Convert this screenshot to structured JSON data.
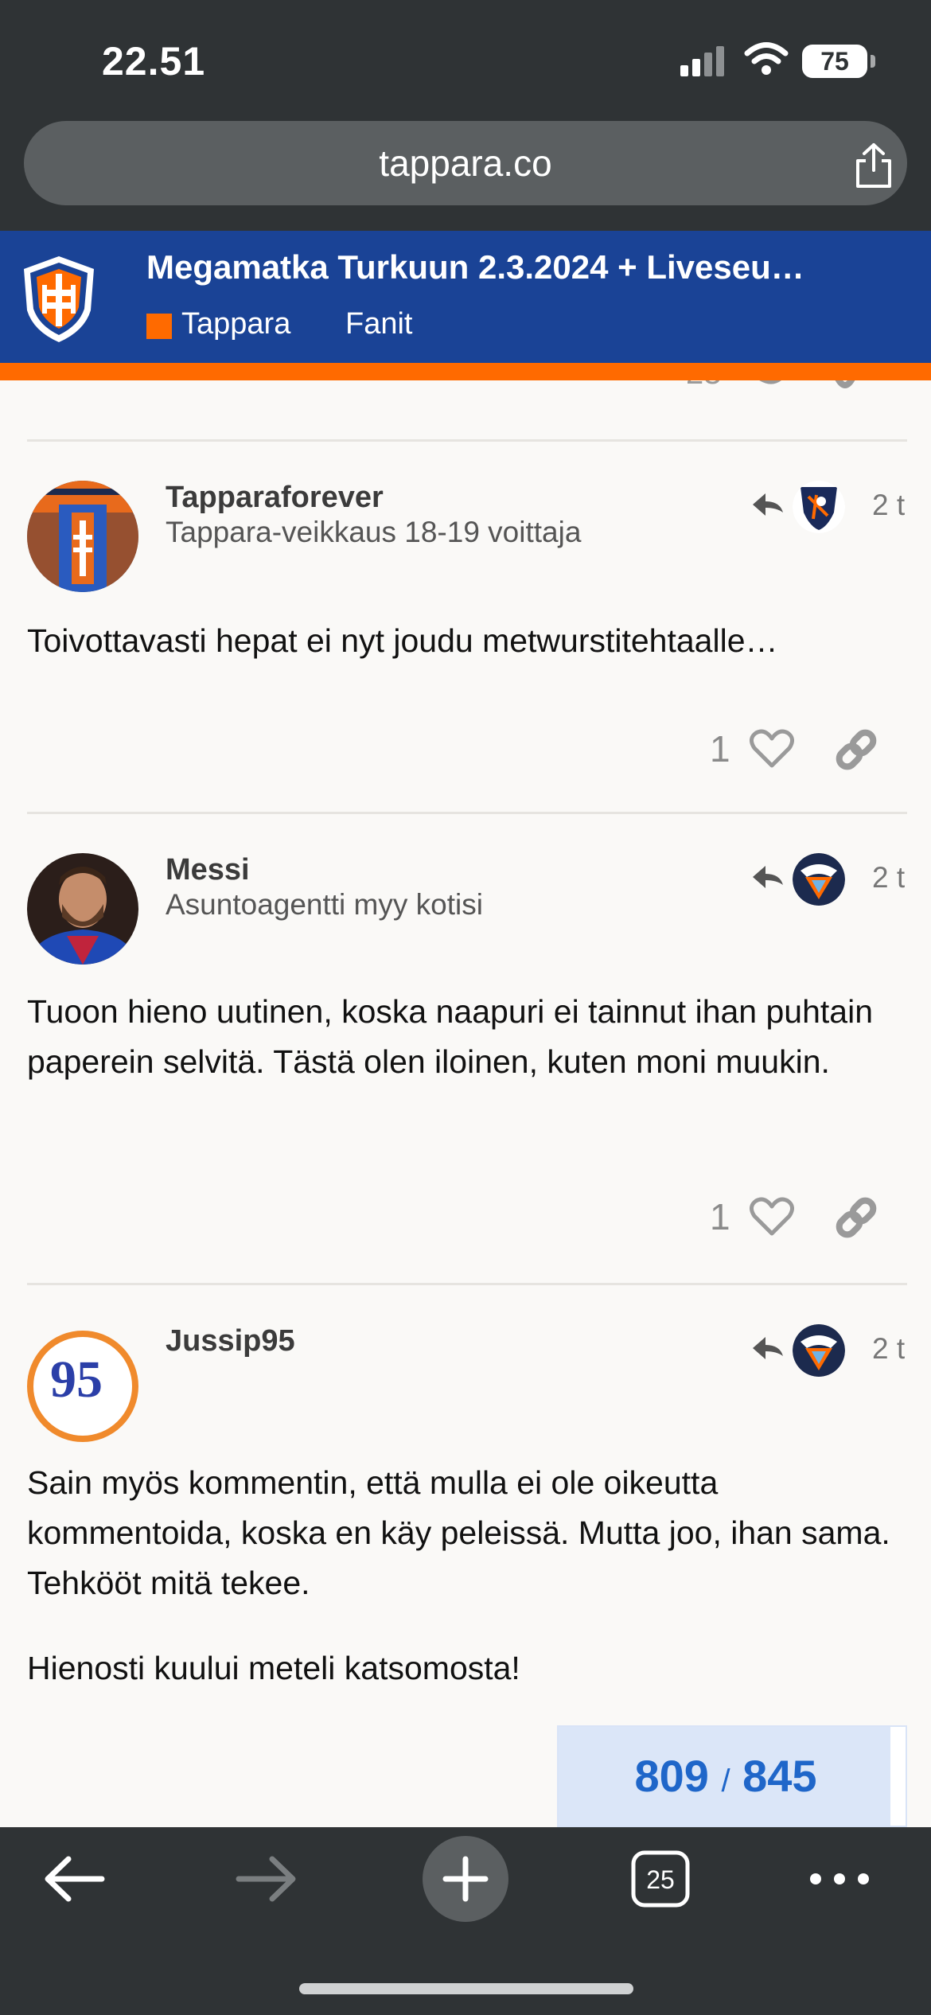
{
  "status_bar": {
    "time": "22.51",
    "battery": "75"
  },
  "browser": {
    "url": "tappara.co",
    "tab_count": "25"
  },
  "forum": {
    "topic_title": "Megamatka Turkuun 2.3.2024 + Liveseu…",
    "category": "Tappara",
    "subcategory": "Fanit",
    "accent_color": "#ff6a00",
    "header_color": "#1a4396"
  },
  "posts": [
    {
      "username": "Tapparaforever",
      "user_title": "Tappara-veikkaus 18-19 voittaja",
      "date": "2 t",
      "body": [
        "Toivottavasti hepat ei nyt joudu metwurstitehtaalle…"
      ],
      "likes": "1",
      "avatar_icon": "scarf-avatar",
      "badge_icon": "player-badge-icon"
    },
    {
      "username": "Messi",
      "user_title": "Asuntoagentti myy kotisi",
      "date": "2 t",
      "body": [
        "Tuoon hieno uutinen, koska naapuri ei tainnut ihan puhtain paperein selvitä. Tästä olen iloinen, kuten moni muukin."
      ],
      "likes": "1",
      "avatar_icon": "portrait-avatar",
      "badge_icon": "tappara-badge-icon"
    },
    {
      "username": "Jussip95",
      "user_title": "",
      "date": "2 t",
      "body": [
        "Sain myös kommentin, että mulla ei ole oikeutta kommentoida, koska en käy peleissä. Mutta joo, ihan sama. Tehkööt mitä tekee.",
        "Hienosti kuului meteli katsomosta!"
      ],
      "avatar_text": "95",
      "badge_icon": "tappara-badge-icon"
    }
  ],
  "progress": {
    "current": "809",
    "separator": "/",
    "total": "845",
    "fraction": 0.9574
  }
}
